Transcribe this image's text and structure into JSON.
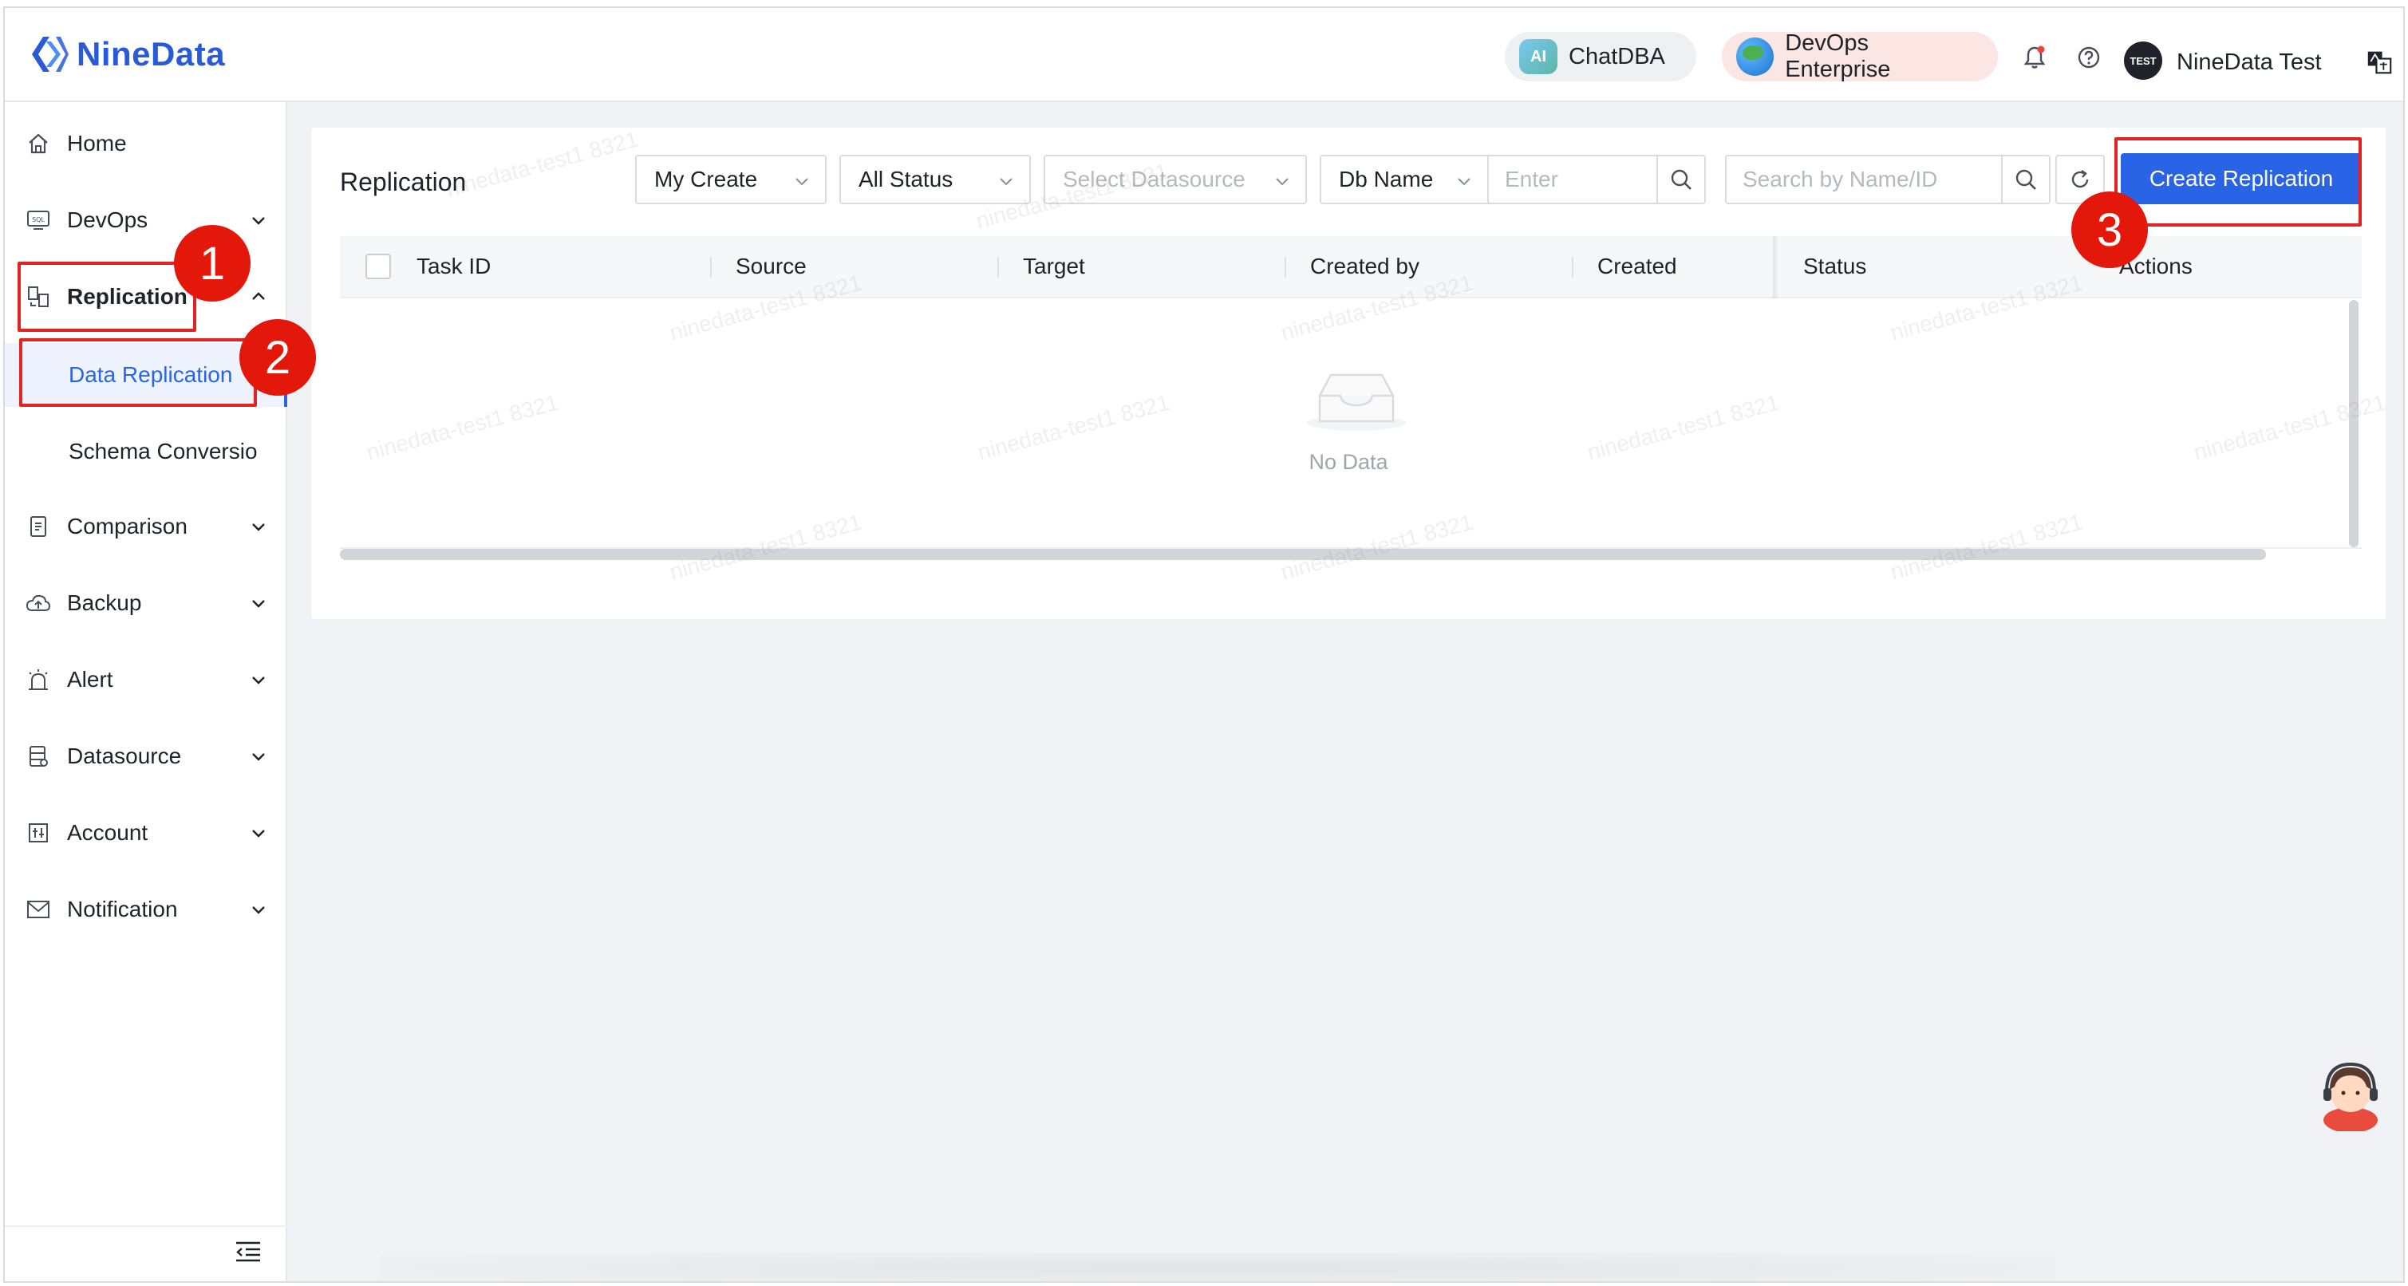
{
  "brand": {
    "name": "NineData",
    "color": "#2a5bd7"
  },
  "header": {
    "chatdba_label": "ChatDBA",
    "ai_badge": "AI",
    "devops_label": "DevOps Enterprise",
    "avatar_text": "TEST",
    "user_name": "NineData Test"
  },
  "sidebar": {
    "items": [
      {
        "label": "Home",
        "icon": "home-icon"
      },
      {
        "label": "DevOps",
        "icon": "sql-icon"
      },
      {
        "label": "Replication",
        "icon": "replication-icon"
      },
      {
        "label": "Comparison",
        "icon": "comparison-icon"
      },
      {
        "label": "Backup",
        "icon": "cloud-backup-icon"
      },
      {
        "label": "Alert",
        "icon": "alarm-icon"
      },
      {
        "label": "Datasource",
        "icon": "datasource-icon"
      },
      {
        "label": "Account",
        "icon": "account-icon"
      },
      {
        "label": "Notification",
        "icon": "mail-icon"
      }
    ],
    "replication_sub": [
      {
        "label": "Data Replication",
        "active": true
      },
      {
        "label": "Schema Conversio",
        "active": false
      }
    ]
  },
  "main": {
    "title": "Replication",
    "filters": {
      "owner": "My Create",
      "status": "All Status",
      "datasource_placeholder": "Select Datasource",
      "db_field": "Db Name",
      "db_placeholder": "Enter",
      "search_placeholder": "Search by Name/ID"
    },
    "create_button": "Create Replication",
    "columns": [
      "Task ID",
      "Source",
      "Target",
      "Created by",
      "Created",
      "Status",
      "Actions"
    ],
    "empty_text": "No Data"
  },
  "watermark": "ninedata-test1 8321",
  "annotations": [
    "1",
    "2",
    "3"
  ],
  "colors": {
    "primary": "#2a64e6",
    "annotation": "#e3170a"
  }
}
